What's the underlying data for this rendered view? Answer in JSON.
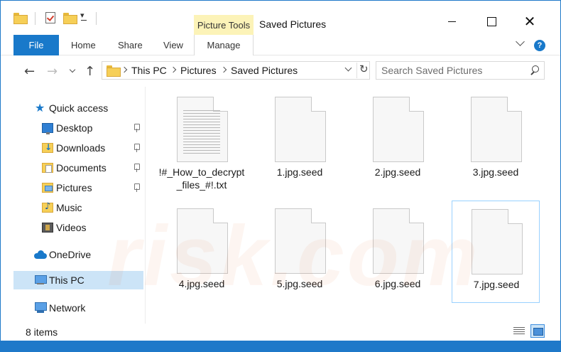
{
  "window": {
    "title": "Saved Pictures",
    "contextual_tab_group": "Picture Tools",
    "close_glyph": "✕"
  },
  "ribbon": {
    "tabs": [
      {
        "label": "File"
      },
      {
        "label": "Home"
      },
      {
        "label": "Share"
      },
      {
        "label": "View"
      },
      {
        "label": "Manage"
      }
    ],
    "help_glyph": "?"
  },
  "navigation": {
    "back_glyph": "←",
    "forward_glyph": "→",
    "up_glyph": "↑",
    "refresh_glyph": "↻"
  },
  "address": {
    "breadcrumbs": [
      "This PC",
      "Pictures",
      "Saved Pictures"
    ]
  },
  "search": {
    "placeholder": "Search Saved Pictures"
  },
  "sidebar": {
    "quick_access": {
      "label": "Quick access",
      "icon": "star-icon"
    },
    "items": [
      {
        "label": "Desktop",
        "icon": "desktop-folder-icon",
        "pinned": true
      },
      {
        "label": "Downloads",
        "icon": "downloads-folder-icon",
        "pinned": true
      },
      {
        "label": "Documents",
        "icon": "documents-folder-icon",
        "pinned": true
      },
      {
        "label": "Pictures",
        "icon": "pictures-folder-icon",
        "pinned": true
      },
      {
        "label": "Music",
        "icon": "music-folder-icon",
        "pinned": false
      },
      {
        "label": "Videos",
        "icon": "videos-folder-icon",
        "pinned": false
      }
    ],
    "onedrive": {
      "label": "OneDrive",
      "icon": "cloud-icon"
    },
    "this_pc": {
      "label": "This PC",
      "icon": "computer-icon",
      "selected": true
    },
    "network": {
      "label": "Network",
      "icon": "network-icon"
    }
  },
  "files": [
    {
      "name": "!#_How_to_decrypt_files_#!.txt",
      "type": "text-file-icon"
    },
    {
      "name": "1.jpg.seed",
      "type": "blank-file-icon"
    },
    {
      "name": "2.jpg.seed",
      "type": "blank-file-icon"
    },
    {
      "name": "3.jpg.seed",
      "type": "blank-file-icon"
    },
    {
      "name": "4.jpg.seed",
      "type": "blank-file-icon"
    },
    {
      "name": "5.jpg.seed",
      "type": "blank-file-icon"
    },
    {
      "name": "6.jpg.seed",
      "type": "blank-file-icon"
    },
    {
      "name": "7.jpg.seed",
      "type": "blank-file-icon",
      "focused": true
    }
  ],
  "status": {
    "item_count": "8 items"
  },
  "colors": {
    "accent": "#1979ca",
    "picture_tools_highlight": "#fcf3b8",
    "selection": "#cce4f7"
  }
}
